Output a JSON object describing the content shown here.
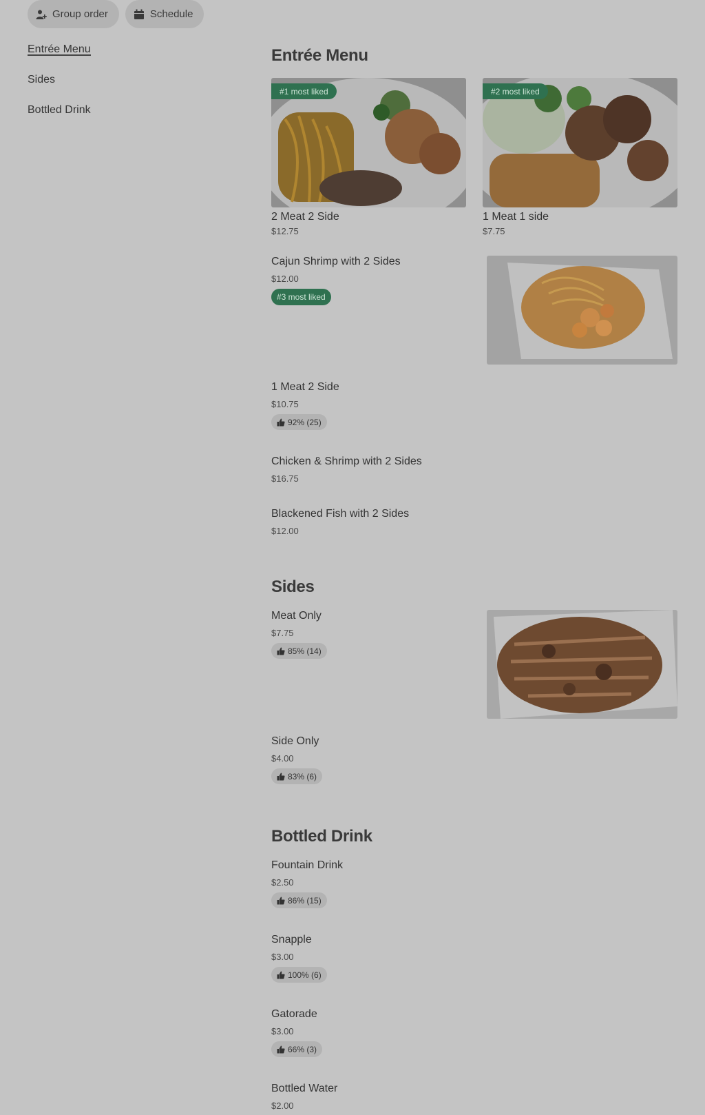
{
  "header": {
    "group_order_label": "Group order",
    "schedule_label": "Schedule"
  },
  "sidebar": {
    "items": [
      {
        "label": "Entrée Menu"
      },
      {
        "label": "Sides"
      },
      {
        "label": "Bottled Drink"
      }
    ]
  },
  "entree": {
    "title": "Entrée Menu",
    "featured": [
      {
        "name": "2 Meat 2 Side",
        "price": "$12.75",
        "badge": "#1 most liked"
      },
      {
        "name": "1 Meat 1 side",
        "price": "$7.75",
        "badge": "#2 most liked"
      }
    ],
    "items": [
      {
        "name": "Cajun Shrimp with 2 Sides",
        "price": "$12.00",
        "badge": "#3 most liked"
      },
      {
        "name": "1 Meat 2 Side",
        "price": "$10.75",
        "rating": "92% (25)"
      },
      {
        "name": "Chicken & Shrimp with 2 Sides",
        "price": "$16.75"
      },
      {
        "name": "Blackened Fish with 2 Sides",
        "price": "$12.00"
      }
    ]
  },
  "sides": {
    "title": "Sides",
    "items": [
      {
        "name": "Meat Only",
        "price": "$7.75",
        "rating": "85% (14)"
      },
      {
        "name": "Side Only",
        "price": "$4.00",
        "rating": "83% (6)"
      }
    ]
  },
  "drinks": {
    "title": "Bottled Drink",
    "items": [
      {
        "name": "Fountain Drink",
        "price": "$2.50",
        "rating": "86% (15)"
      },
      {
        "name": "Snapple",
        "price": "$3.00",
        "rating": "100% (6)"
      },
      {
        "name": "Gatorade",
        "price": "$3.00",
        "rating": "66% (3)"
      },
      {
        "name": "Bottled Water",
        "price": "$2.00"
      }
    ]
  },
  "colors": {
    "background": "#c4c4c4",
    "badge_green": "#2f7150",
    "pill_gray": "#b3b3b3"
  },
  "icons": {
    "group_order": "person-plus-icon",
    "schedule": "calendar-icon",
    "rating": "thumbs-up-icon"
  }
}
